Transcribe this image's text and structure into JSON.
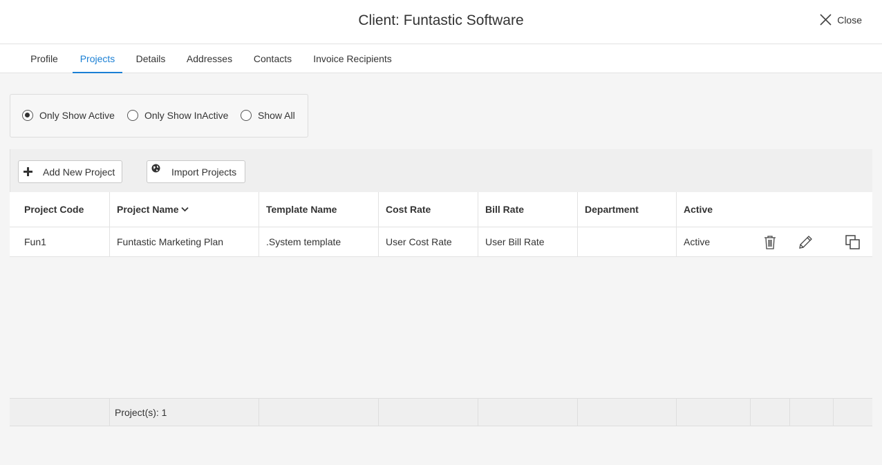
{
  "header": {
    "title": "Client: Funtastic Software",
    "close_label": "Close"
  },
  "tabs": [
    {
      "label": "Profile"
    },
    {
      "label": "Projects",
      "active": true
    },
    {
      "label": "Details"
    },
    {
      "label": "Addresses"
    },
    {
      "label": "Contacts"
    },
    {
      "label": "Invoice Recipients"
    }
  ],
  "filter": {
    "options": [
      {
        "label": "Only Show Active",
        "checked": true
      },
      {
        "label": "Only Show InActive",
        "checked": false
      },
      {
        "label": "Show All",
        "checked": false
      }
    ]
  },
  "toolbar": {
    "add_label": "Add New Project",
    "import_label": "Import Projects"
  },
  "table": {
    "columns": [
      "Project Code",
      "Project Name",
      "Template Name",
      "Cost Rate",
      "Bill Rate",
      "Department",
      "Active"
    ],
    "rows": [
      [
        "Fun1",
        "Funtastic Marketing Plan",
        ".System template",
        "User Cost Rate",
        "User Bill Rate",
        "",
        "Active"
      ]
    ]
  },
  "footer": {
    "count_label": "Project(s): 1"
  },
  "colors": {
    "accent": "#1a7fd4"
  }
}
